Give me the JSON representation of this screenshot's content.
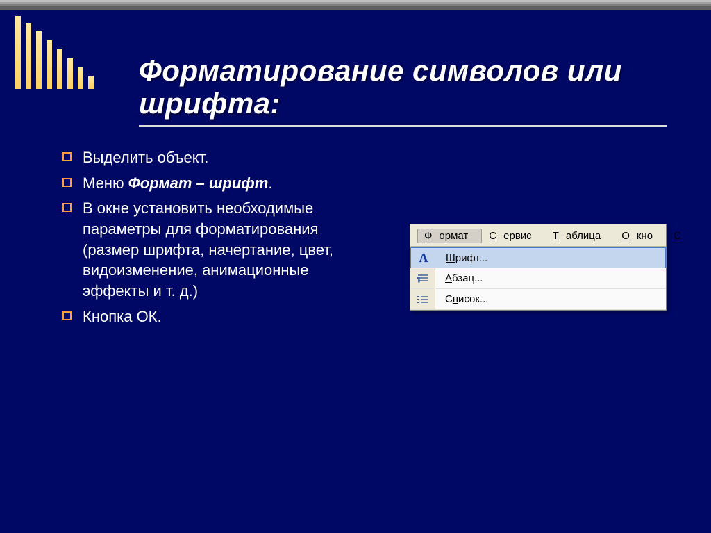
{
  "title": "Форматирование символов или шрифта:",
  "bullets": [
    {
      "plain": "Выделить объект."
    },
    {
      "prefix": "Меню ",
      "em": "Формат – шрифт",
      "suffix": "."
    },
    {
      "plain": "В окне установить необходимые параметры для форматирования (размер шрифта, начертание, цвет, видоизменение, анимационные эффекты и т. д.)"
    },
    {
      "plain": "Кнопка ОК."
    }
  ],
  "menubar": {
    "items": [
      {
        "u": "Ф",
        "rest": "ормат",
        "active": true
      },
      {
        "u": "С",
        "rest": "ервис"
      },
      {
        "u": "Т",
        "rest": "аблица"
      },
      {
        "u": "О",
        "rest": "кно"
      },
      {
        "u": "С",
        "rest": ""
      }
    ]
  },
  "dropdown": [
    {
      "icon": "font",
      "u": "Ш",
      "rest": "рифт...",
      "highlighted": true
    },
    {
      "icon": "para",
      "u": "А",
      "rest": "бзац..."
    },
    {
      "icon": "list",
      "rest_pre": "С",
      "u": "п",
      "rest": "исок..."
    }
  ]
}
